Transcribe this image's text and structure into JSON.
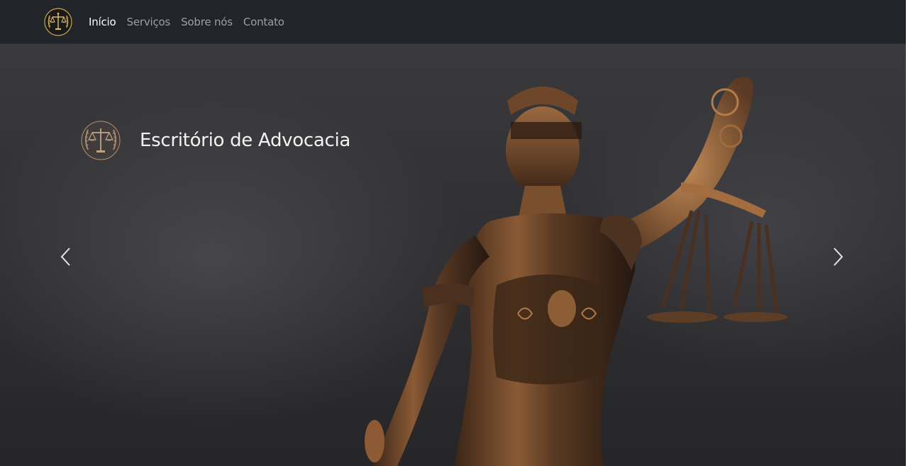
{
  "nav": {
    "brand_icon": "scales-of-justice-emblem",
    "links": [
      {
        "label": "Início",
        "active": true
      },
      {
        "label": "Serviços",
        "active": false
      },
      {
        "label": "Sobre nós",
        "active": false
      },
      {
        "label": "Contato",
        "active": false
      }
    ]
  },
  "carousel": {
    "slide_image": "lady-justice-bronze-statue",
    "caption_title": "Escritório de Advocacia",
    "caption_icon": "scales-of-justice-emblem",
    "prev_icon": "chevron-left-icon",
    "next_icon": "chevron-right-icon"
  },
  "colors": {
    "navbar_bg": "#212429",
    "nav_active": "#ffffff",
    "nav_inactive": "#9aa0a6",
    "brand_gold": "#c9a54a",
    "bronze": "#8a5a35"
  }
}
